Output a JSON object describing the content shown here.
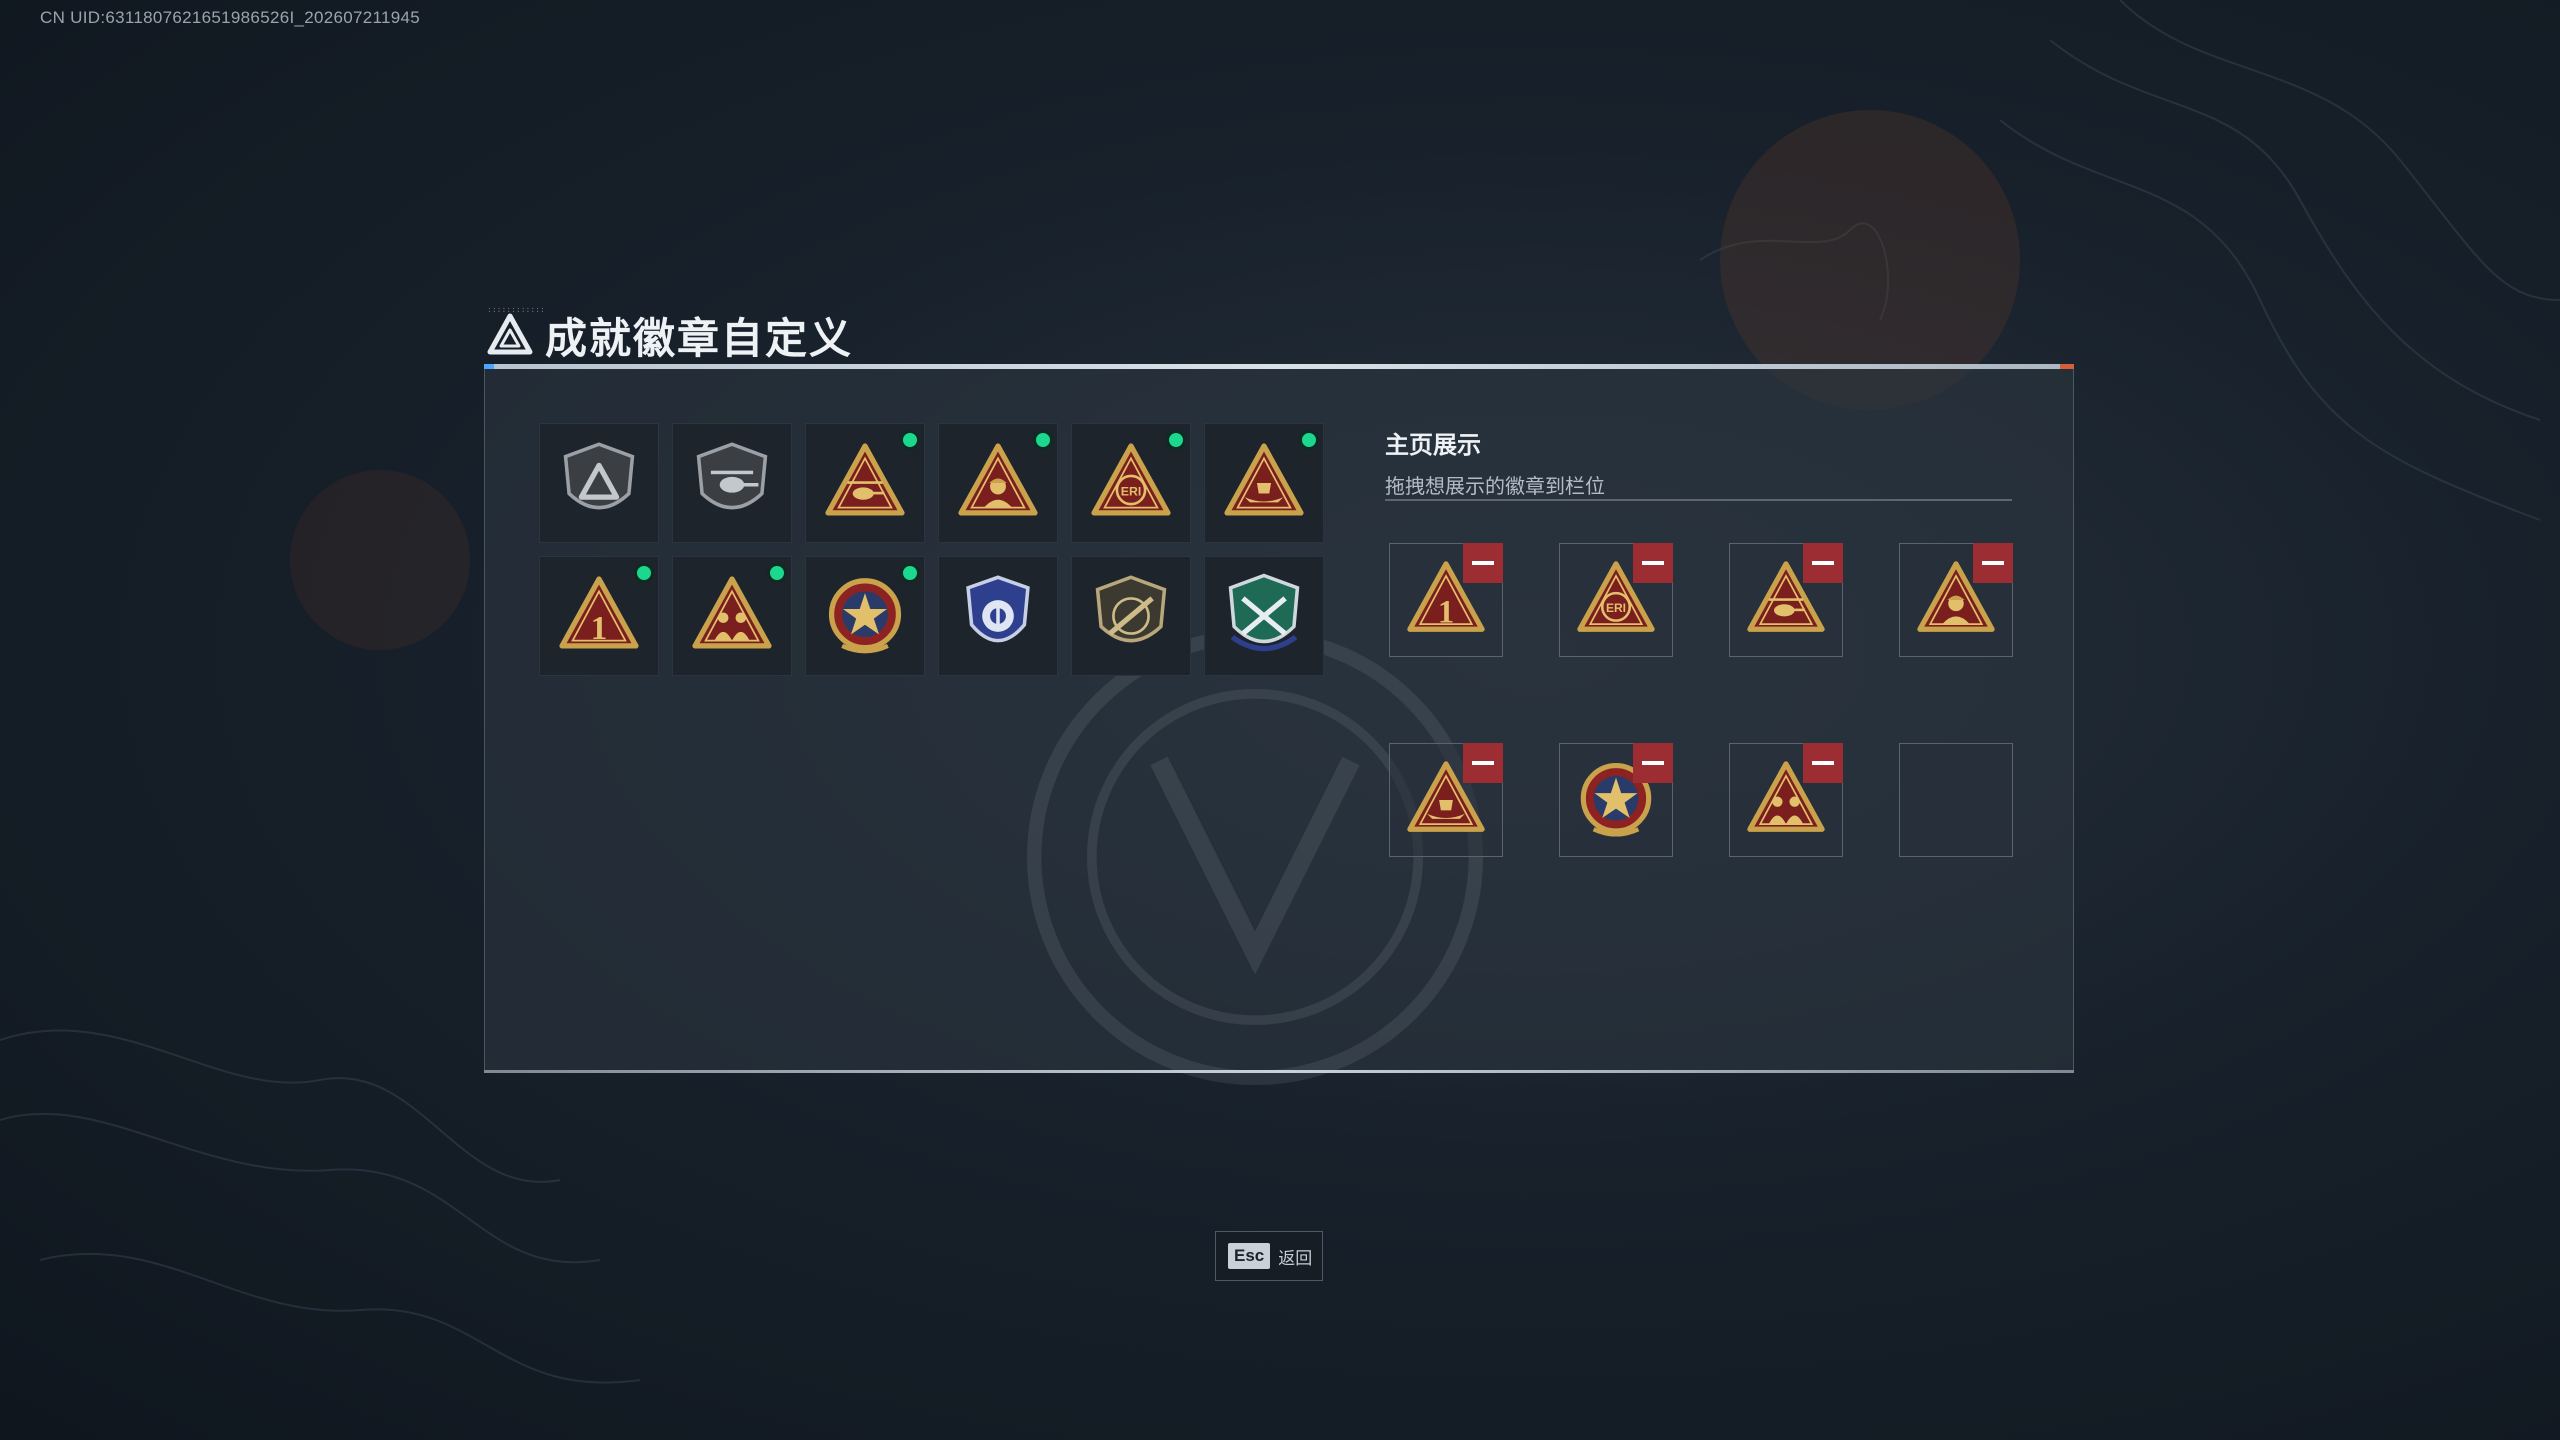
{
  "uid_text": "CN UID:6311807621651986526I_202607211945",
  "title": "成就徽章自定义",
  "showcase": {
    "title": "主页展示",
    "subtitle": "拖拽想展示的徽章到栏位"
  },
  "badges": [
    {
      "icon": "shield-triangle-icon",
      "new": false
    },
    {
      "icon": "helicopter-shield-icon",
      "new": false
    },
    {
      "icon": "gold-triangle-helicopter-icon",
      "new": true
    },
    {
      "icon": "gold-triangle-soldier-icon",
      "new": true
    },
    {
      "icon": "gold-triangle-eri-globe-icon",
      "new": true
    },
    {
      "icon": "gold-triangle-boat-icon",
      "new": true
    },
    {
      "icon": "gold-triangle-number-one-icon",
      "new": true
    },
    {
      "icon": "gold-triangle-squad-icon",
      "new": true
    },
    {
      "icon": "star-medal-icon",
      "new": true
    },
    {
      "icon": "blue-police-badge-icon",
      "new": false
    },
    {
      "icon": "rifle-shield-icon",
      "new": false
    },
    {
      "icon": "green-crossed-rifles-shield-icon",
      "new": false
    }
  ],
  "slots": [
    {
      "icon": "gold-triangle-number-one-icon",
      "filled": true
    },
    {
      "icon": "gold-triangle-eri-globe-icon",
      "filled": true
    },
    {
      "icon": "gold-triangle-helicopter-icon",
      "filled": true
    },
    {
      "icon": "gold-triangle-soldier-icon",
      "filled": true
    },
    {
      "icon": "gold-triangle-boat-icon",
      "filled": true
    },
    {
      "icon": "star-medal-icon",
      "filled": true
    },
    {
      "icon": "gold-triangle-squad-icon",
      "filled": true
    },
    {
      "icon": "",
      "filled": false
    }
  ],
  "esc": {
    "key": "Esc",
    "label": "返回"
  },
  "colors": {
    "gold": "#c9a24b",
    "badge_red": "#7a1e1e",
    "new_dot": "#1bd88e",
    "remove_red": "#9b2d33"
  }
}
